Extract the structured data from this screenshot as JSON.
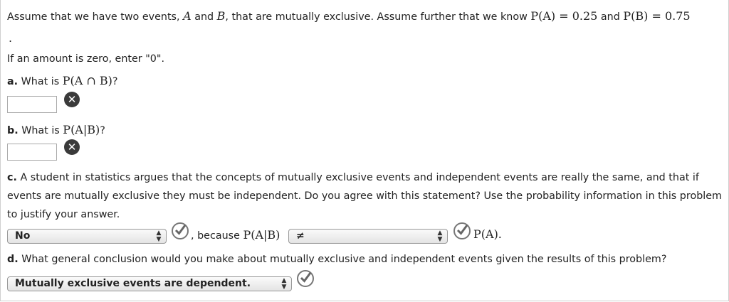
{
  "intro": {
    "prefix": "Assume that we have two events, ",
    "var_a": "A",
    "and1": " and ",
    "var_b": "B",
    "mid": ", that are mutually exclusive. Assume further that we know ",
    "pa": "P(A) = 0.25",
    "and2": " and ",
    "pb": "P(B) = 0.75",
    "dot": "."
  },
  "note": "If an amount is zero, enter \"0\".",
  "question_a": {
    "label": "a.",
    "text": " What is ",
    "expr": "P(A ∩ B)",
    "tail": "?",
    "input_value": ""
  },
  "question_b": {
    "label": "b.",
    "text": " What is ",
    "expr": "P(A|B)",
    "tail": "?",
    "input_value": ""
  },
  "question_c": {
    "label": "c.",
    "text": " A student in statistics argues that the concepts of mutually exclusive events and independent events are really the same, and that if events are mutually exclusive they must be independent. Do you agree with this statement? Use the probability information in this problem to justify your answer.",
    "select1_value": "No",
    "because": ", because ",
    "expr": "P(A|B)",
    "select2_value": "≠",
    "tail_expr": "P(A)."
  },
  "question_d": {
    "label": "d.",
    "text": " What general conclusion would you make about mutually exclusive and independent events given the results of this problem?",
    "select_value": "Mutually exclusive events are dependent."
  },
  "icons": {
    "incorrect": "x-circle-icon",
    "correct": "check-circle-icon"
  }
}
